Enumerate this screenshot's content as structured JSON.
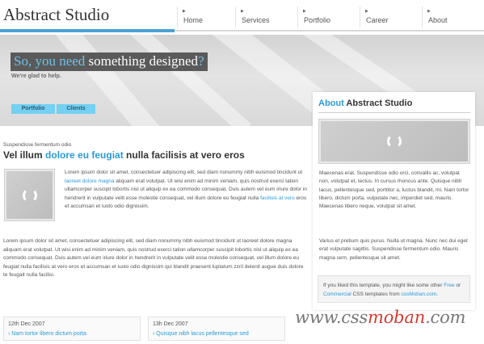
{
  "header": {
    "brand": "Abstract Studio",
    "nav": [
      {
        "label": "Home"
      },
      {
        "label": "Services"
      },
      {
        "label": "Portfolio"
      },
      {
        "label": "Career"
      },
      {
        "label": "About"
      }
    ]
  },
  "banner": {
    "headline_blue": "So, you need",
    "headline_rest": " something designed",
    "headline_end": "?",
    "subline": "We're glad to help.",
    "tabs": [
      {
        "label": "Portfolio"
      },
      {
        "label": "Clients"
      }
    ]
  },
  "sidebar": {
    "title_blue": "About",
    "title_rest": " Abstract Studio",
    "para1": "Maecenas erat. Suspendisse odio orci, convallis ac, volutpat non, volutpat et, lectus. In cursus rhoncus ante. Quisque nibh lacus, pellentesque sed, porttitor a, luctus blandit, mi. Nam tortor libero, dictum porta, vulputate nec, imperdiet sed, mauris. Maecenas libero neque, volutpat sit amet.",
    "para2": "Varius et pretium quis purus. Nulla ut magna. Nunc nec dui eget erat vulputate sagittis. Suspendisse fermentum odio. Mauris magna sem, pellentesque sit amet.",
    "box_text1": "If you liked this template, you might like some other ",
    "box_link1": "Free",
    "box_or": " or ",
    "box_link2": "Commercial",
    "box_text2": " CSS templates from ",
    "box_link3": "cssMoban.com",
    "box_end": "."
  },
  "main": {
    "kicker": "Suspendisse fermentum odio",
    "title_a": "Vel illum ",
    "title_blue": "dolore eu feugiat",
    "title_b": " nulla facilisis at vero eros",
    "p1_a": "Lorem ipsum dolor sit amet, consectetuer adipiscing elit, sed diam nonummy nibh euismod tincidunt ut ",
    "p1_link1": "laoreet dolore magna",
    "p1_b": " aliquam erat volutpat. Ut wisi enim ad minim veniam, quis nostrud exerci tation ullamcorper suscipit lobortis nisl ut aliquip ex ea commodo consequat. Duis autem vel eum iriure dolor in hendrerit in vulputate velit esse molestie consequat, vel illum dolore eu feugiat nulla ",
    "p1_link2": "facilisis at vero",
    "p1_c": " eros et accumsan et iusto odio dignissim.",
    "p2": "Lorem ipsum dolor sit amet, consectetuer adipiscing elit, sed diam nonummy nibh euismod tincidunt ut laoreet dolore magna aliquam erat volutpat. Ut wisi enim ad minim veniam, quis nostrud exerci tation ullamcorper suscipit lobortis nisl ut aliquip ex ea commodo consequat. Duis autem vel eum iriure dolor in hendrerit in vulputate velit esse molestie consequat, vel illum dolore eu feugiat nulla facilisis at vero eros et accumsan et iusto odio dignissim qui blandit praesent luptatum zzril delenit augue duis dolore te feugait nulla facilisi."
  },
  "news": [
    {
      "date": "12th Dec 2007",
      "title": "Nam tortor libero dictum porta"
    },
    {
      "date": "13h Dec 2007",
      "title": "Quisque nibh lacus pellentesque sed"
    }
  ],
  "watermark": {
    "a": "www.css",
    "b": "moban",
    "c": ".com"
  },
  "colors": {
    "accent": "#2a9bd8",
    "brand_bar": "#4aa3d3",
    "tab_bg": "#74d0f2",
    "headline_bg": "#5a5a5a"
  }
}
